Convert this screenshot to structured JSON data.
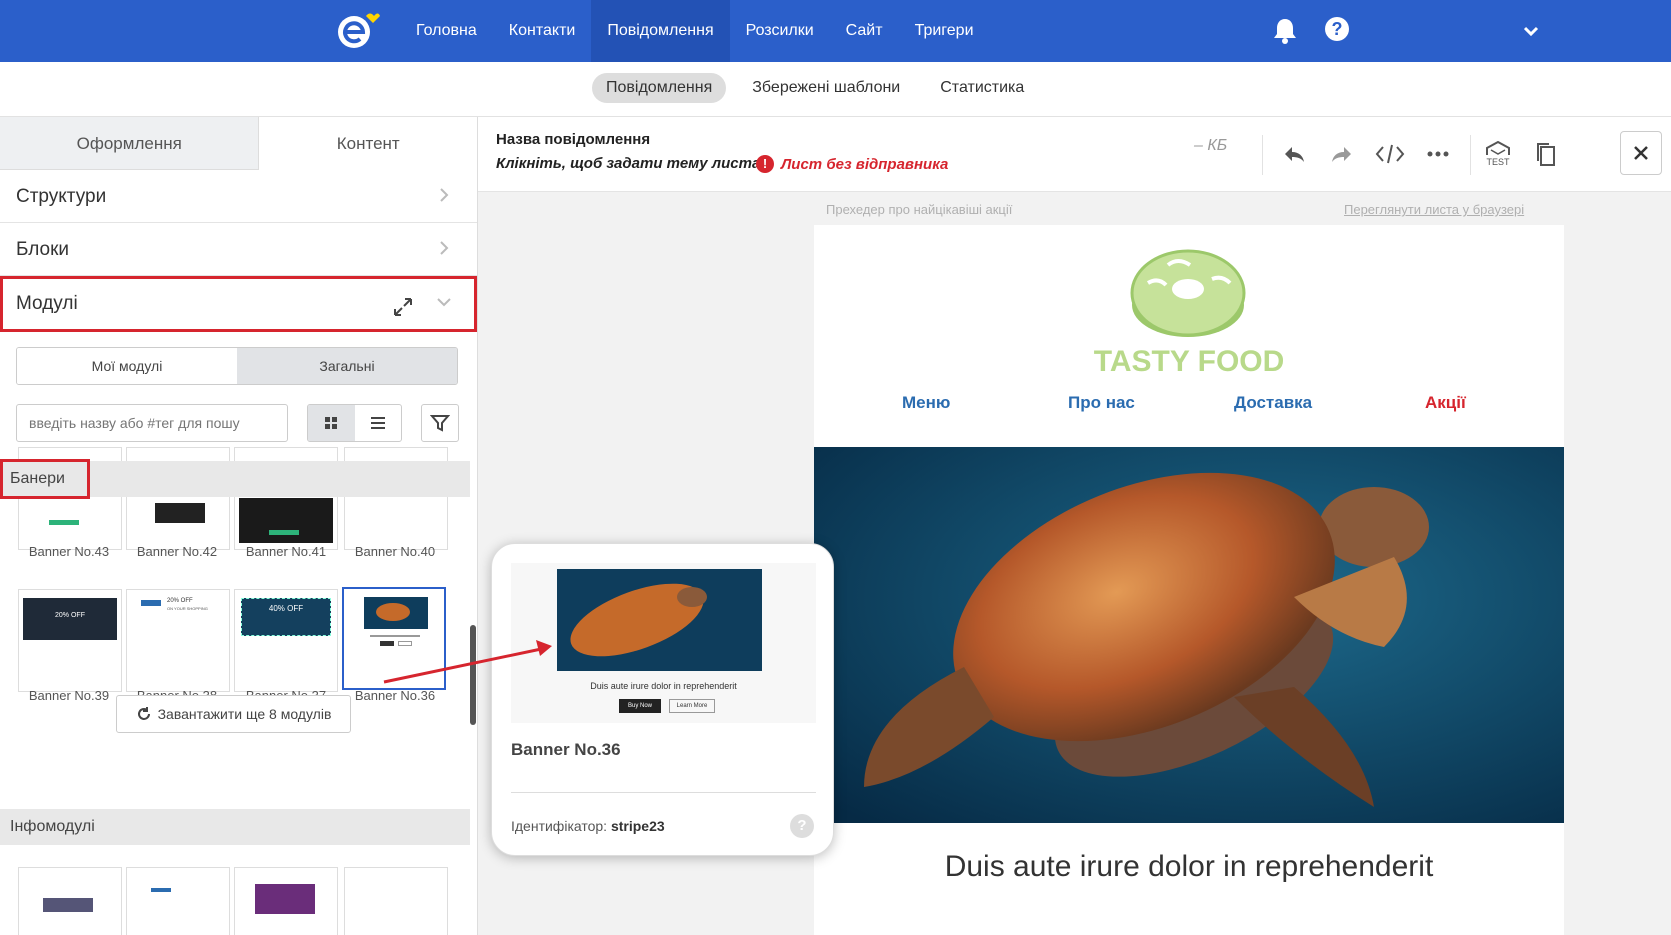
{
  "topbar": {
    "nav": [
      "Головна",
      "Контакти",
      "Повідомлення",
      "Розсилки",
      "Сайт",
      "Тригери"
    ],
    "active_index": 2,
    "colors": {
      "bar": "#2b5fca",
      "active": "#2352b5"
    }
  },
  "subnav": {
    "items": [
      "Повідомлення",
      "Збережені шаблони",
      "Статистика"
    ],
    "active_index": 0
  },
  "left": {
    "tabs": [
      "Оформлення",
      "Контент"
    ],
    "active_tab": 1,
    "accordion": [
      "Структури",
      "Блоки",
      "Модулі"
    ],
    "segments": [
      "Мої модулі",
      "Загальні"
    ],
    "active_segment": 1,
    "search_placeholder": "введіть назву або #тег для пошу",
    "banners_title": "Банери",
    "banners_row1": [
      "Banner No.43",
      "Banner No.42",
      "Banner No.41",
      "Banner No.40"
    ],
    "banners_row2": [
      "Banner No.39",
      "Banner No.38",
      "Banner No.37",
      "Banner No.36"
    ],
    "load_more": "Завантажити ще 8 модулів",
    "info_title": "Інфомодулі"
  },
  "card": {
    "title": "Banner No.36",
    "id_label": "Ідентифікатор:",
    "id_value": "stripe23",
    "preview_text": "Duis aute irure dolor in reprehenderit",
    "preview_btn1": "Buy Now",
    "preview_btn2": "Learn More",
    "help": "?"
  },
  "toolbar": {
    "message_name": "Назва повідомлення",
    "subject_hint": "Клікніть, щоб задати тему листа",
    "warning": "Лист без відправника",
    "size": "– КБ",
    "test_label": "TEST"
  },
  "email": {
    "preheader": "Прехедер про найцікавіші акції",
    "webview": "Переглянути листа у браузері",
    "brand": "TASTY FOOD",
    "menu": [
      "Меню",
      "Про нас",
      "Доставка",
      "Акції"
    ],
    "headline": "Duis aute irure dolor in reprehenderit"
  },
  "thumb_texts": {
    "pct20": "20% OFF",
    "pct40": "40% OFF",
    "shopping": "ON YOUR SHOPPING"
  },
  "icons": [
    "logo-icon",
    "bell-icon",
    "help-icon",
    "chevron-down-icon",
    "chevron-right-icon",
    "expand-icon",
    "grid-icon",
    "list-icon",
    "filter-icon",
    "refresh-icon",
    "undo-icon",
    "redo-icon",
    "code-icon",
    "more-icon",
    "test-icon",
    "copy-icon",
    "close-icon"
  ]
}
